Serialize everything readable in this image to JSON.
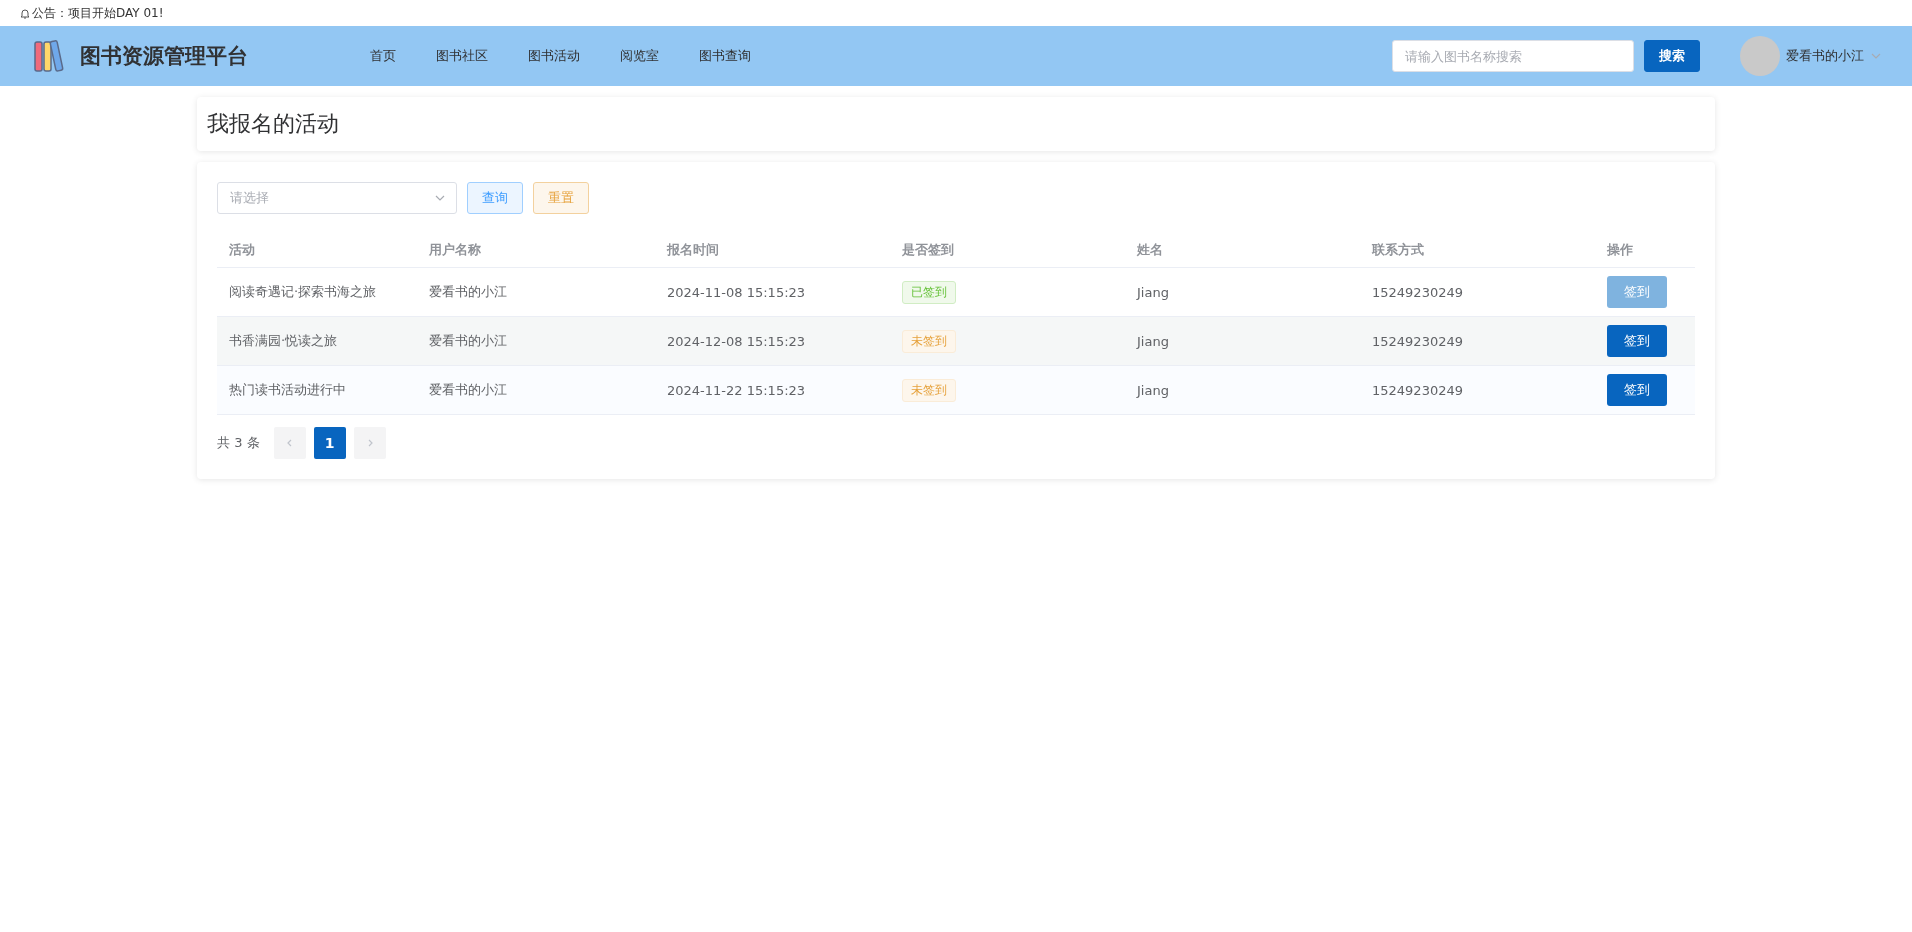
{
  "notice": "公告：项目开始DAY 01!",
  "header": {
    "title": "图书资源管理平台",
    "nav": [
      {
        "label": "首页"
      },
      {
        "label": "图书社区"
      },
      {
        "label": "图书活动"
      },
      {
        "label": "阅览室"
      },
      {
        "label": "图书查询"
      }
    ],
    "search": {
      "placeholder": "请输入图书名称搜索",
      "button": "搜索"
    },
    "user": {
      "name": "爱看书的小江"
    }
  },
  "page_title": "我报名的活动",
  "filter": {
    "placeholder": "请选择",
    "query_button": "查询",
    "reset_button": "重置"
  },
  "table": {
    "columns": [
      "活动",
      "用户名称",
      "报名时间",
      "是否签到",
      "姓名",
      "联系方式",
      "操作"
    ],
    "rows": [
      {
        "activity": "阅读奇遇记·探索书海之旅",
        "user": "爱看书的小江",
        "time": "2024-11-08 15:15:23",
        "status": "已签到",
        "signed": true,
        "name": "Jiang",
        "phone": "15249230249",
        "action": "签到"
      },
      {
        "activity": "书香满园·悦读之旅",
        "user": "爱看书的小江",
        "time": "2024-12-08 15:15:23",
        "status": "未签到",
        "signed": false,
        "name": "Jiang",
        "phone": "15249230249",
        "action": "签到"
      },
      {
        "activity": "热门读书活动进行中",
        "user": "爱看书的小江",
        "time": "2024-11-22 15:15:23",
        "status": "未签到",
        "signed": false,
        "name": "Jiang",
        "phone": "15249230249",
        "action": "签到"
      }
    ]
  },
  "pagination": {
    "total": "共 3 条",
    "pages": [
      {
        "label": "1",
        "selected": true
      }
    ]
  }
}
